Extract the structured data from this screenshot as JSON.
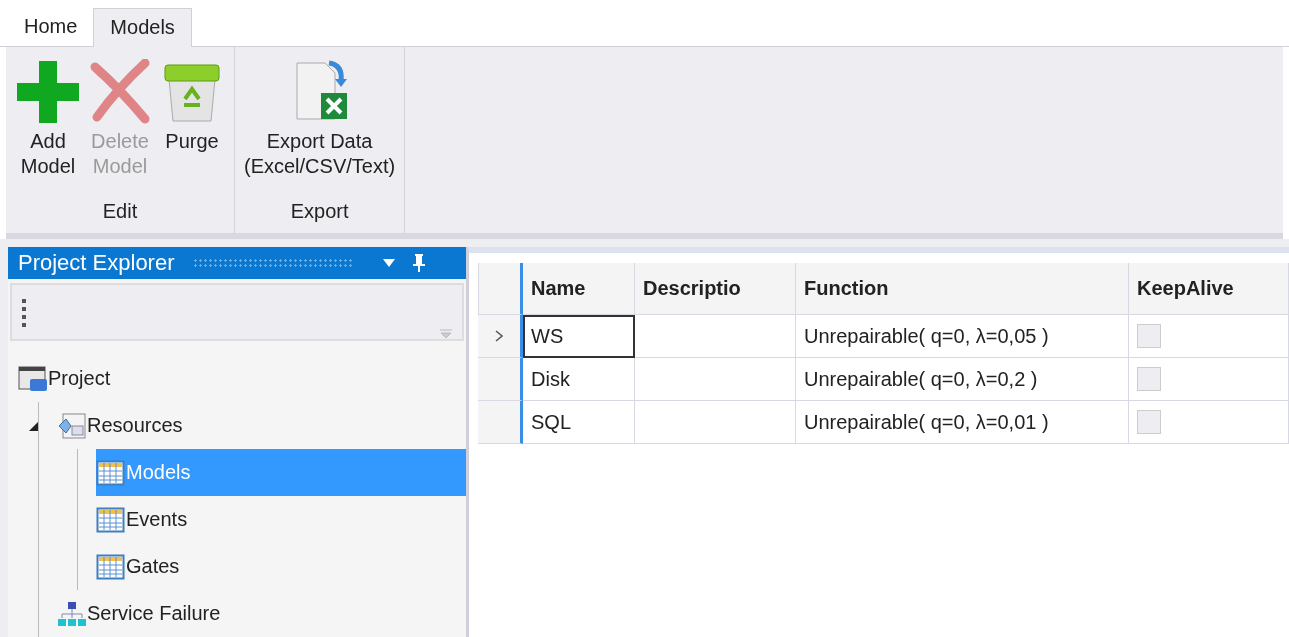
{
  "tabs": [
    {
      "label": "Home",
      "selected": false
    },
    {
      "label": "Models",
      "selected": true
    }
  ],
  "ribbon": {
    "groups": [
      {
        "label": "Edit",
        "buttons": [
          {
            "kind": "add",
            "label": "Add\nModel",
            "disabled": false
          },
          {
            "kind": "delete",
            "label": "Delete\nModel",
            "disabled": true
          },
          {
            "kind": "purge",
            "label": "Purge",
            "disabled": false
          }
        ]
      },
      {
        "label": "Export",
        "buttons": [
          {
            "kind": "export",
            "label": "Export Data\n(Excel/CSV/Text)",
            "disabled": false
          }
        ]
      }
    ]
  },
  "project_explorer": {
    "title": "Project Explorer",
    "tree": [
      {
        "label": "Project",
        "kind": "project",
        "selected": false,
        "children": [
          {
            "label": "Resources",
            "kind": "resources",
            "selected": false,
            "expanded": true,
            "children": [
              {
                "label": "Models",
                "kind": "table",
                "selected": true
              },
              {
                "label": "Events",
                "kind": "table",
                "selected": false
              },
              {
                "label": "Gates",
                "kind": "table",
                "selected": false
              }
            ]
          },
          {
            "label": "Service Failure",
            "kind": "hierarchy",
            "selected": false
          }
        ]
      }
    ]
  },
  "table": {
    "columns": [
      "Name",
      "Descriptio",
      "Function",
      "KeepAlive"
    ],
    "rows": [
      {
        "current": true,
        "name": "WS",
        "description": "",
        "function": "Unrepairable( q=0, λ=0,05 )",
        "keepalive": false
      },
      {
        "current": false,
        "name": "Disk",
        "description": "",
        "function": "Unrepairable( q=0, λ=0,2 )",
        "keepalive": false
      },
      {
        "current": false,
        "name": "SQL",
        "description": "",
        "function": "Unrepairable( q=0, λ=0,01 )",
        "keepalive": false
      }
    ]
  }
}
